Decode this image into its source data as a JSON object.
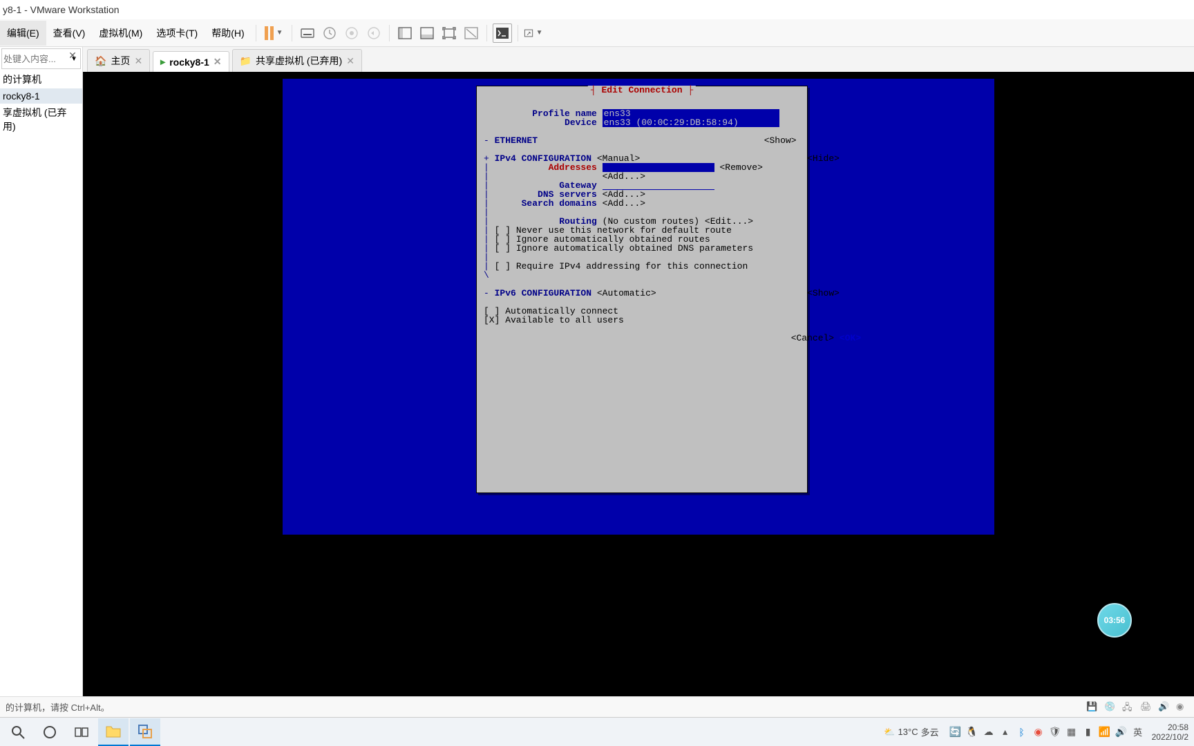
{
  "window": {
    "title": "y8-1 - VMware Workstation"
  },
  "menu": {
    "edit": "编辑(E)",
    "view": "查看(V)",
    "vm": "虚拟机(M)",
    "tabs": "选项卡(T)",
    "help": "帮助(H)"
  },
  "sidebar": {
    "search_placeholder": "处键入内容...",
    "items": [
      {
        "label": "的计算机"
      },
      {
        "label": "rocky8-1"
      },
      {
        "label": "享虚拟机 (已弃用)"
      }
    ]
  },
  "tabs": [
    {
      "label": "主页",
      "icon": "home",
      "active": false
    },
    {
      "label": "rocky8-1",
      "icon": "vm",
      "active": true
    },
    {
      "label": "共享虚拟机 (已弃用)",
      "icon": "shared",
      "active": false
    }
  ],
  "nmtui": {
    "title_line1": "┤",
    "title_text": " Edit Connection ",
    "title_line2": "├",
    "profile_name_label": "Profile name",
    "profile_name_value": "ens33",
    "device_label": "Device",
    "device_value": "ens33 (00:0C:29:DB:58:94)",
    "ethernet_section": "ETHERNET",
    "ethernet_show": "<Show>",
    "ipv4_section": "IPv4 CONFIGURATION",
    "ipv4_mode": "<Manual>",
    "ipv4_hide": "<Hide>",
    "addresses_label": "Addresses",
    "addresses_remove": "<Remove>",
    "addresses_add": "<Add...>",
    "gateway_label": "Gateway",
    "dns_label": "DNS servers",
    "dns_add": "<Add...>",
    "search_label": "Search domains",
    "search_add": "<Add...>",
    "routing_label": "Routing",
    "routing_value": "(No custom routes)",
    "routing_edit": "<Edit...>",
    "cb_never_default": "[ ] Never use this network for default route",
    "cb_ignore_routes": "[ ] Ignore automatically obtained routes",
    "cb_ignore_dns": "[ ] Ignore automatically obtained DNS parameters",
    "cb_require_ipv4": "[ ] Require IPv4 addressing for this connection",
    "ipv6_section": "IPv6 CONFIGURATION",
    "ipv6_mode": "<Automatic>",
    "ipv6_show": "<Show>",
    "cb_auto_connect": "[ ] Automatically connect",
    "cb_all_users": "[X] Available to all users",
    "cancel_btn": "<Cancel>",
    "ok_btn": "<OK>"
  },
  "statusbar": {
    "text": "的计算机，请按 Ctrl+Alt。"
  },
  "timer": "03:56",
  "taskbar": {
    "weather_temp": "13°C",
    "weather_desc": "多云",
    "ime": "英",
    "time": "20:58",
    "date": "2022/10/2"
  }
}
